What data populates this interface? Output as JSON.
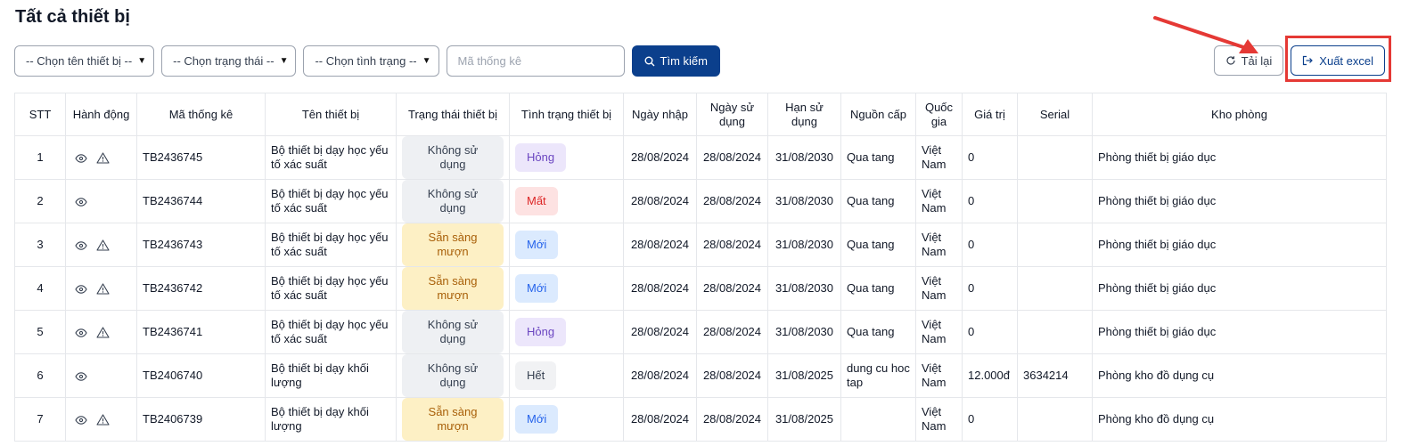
{
  "page_title": "Tất cả thiết bị",
  "filters": {
    "device_name": "-- Chọn tên thiết bị --",
    "status": "-- Chọn trạng thái --",
    "condition": "-- Chọn tình trạng --",
    "code_placeholder": "Mã thống kê",
    "search_label": "Tìm kiếm"
  },
  "actions": {
    "reload_label": "Tải lại",
    "export_label": "Xuất excel"
  },
  "table": {
    "headers": {
      "stt": "STT",
      "actions": "Hành động",
      "code": "Mã thống kê",
      "name": "Tên thiết bị",
      "status": "Trạng thái thiết bị",
      "condition": "Tình trạng thiết bị",
      "import_date": "Ngày nhập",
      "use_date": "Ngày sử dụng",
      "expiry": "Hạn sử dụng",
      "source": "Nguồn cấp",
      "country": "Quốc gia",
      "value": "Giá trị",
      "serial": "Serial",
      "room": "Kho phòng"
    },
    "rows": [
      {
        "stt": "1",
        "warn": true,
        "code": "TB2436745",
        "name": "Bộ thiết bị dạy học yếu tố xác suất",
        "status": "Không sử dụng",
        "status_tone": "gray",
        "condition": "Hỏng",
        "condition_tone": "purple",
        "import_date": "28/08/2024",
        "use_date": "28/08/2024",
        "expiry": "31/08/2030",
        "source": "Qua tang",
        "country": "Việt Nam",
        "value": "0",
        "serial": "",
        "room": "Phòng thiết bị giáo dục"
      },
      {
        "stt": "2",
        "warn": false,
        "code": "TB2436744",
        "name": "Bộ thiết bị dạy học yếu tố xác suất",
        "status": "Không sử dụng",
        "status_tone": "gray",
        "condition": "Mất",
        "condition_tone": "red",
        "import_date": "28/08/2024",
        "use_date": "28/08/2024",
        "expiry": "31/08/2030",
        "source": "Qua tang",
        "country": "Việt Nam",
        "value": "0",
        "serial": "",
        "room": "Phòng thiết bị giáo dục"
      },
      {
        "stt": "3",
        "warn": true,
        "code": "TB2436743",
        "name": "Bộ thiết bị dạy học yếu tố xác suất",
        "status": "Sẵn sàng mượn",
        "status_tone": "yellow",
        "condition": "Mới",
        "condition_tone": "blue",
        "import_date": "28/08/2024",
        "use_date": "28/08/2024",
        "expiry": "31/08/2030",
        "source": "Qua tang",
        "country": "Việt Nam",
        "value": "0",
        "serial": "",
        "room": "Phòng thiết bị giáo dục"
      },
      {
        "stt": "4",
        "warn": true,
        "code": "TB2436742",
        "name": "Bộ thiết bị dạy học yếu tố xác suất",
        "status": "Sẵn sàng mượn",
        "status_tone": "yellow",
        "condition": "Mới",
        "condition_tone": "blue",
        "import_date": "28/08/2024",
        "use_date": "28/08/2024",
        "expiry": "31/08/2030",
        "source": "Qua tang",
        "country": "Việt Nam",
        "value": "0",
        "serial": "",
        "room": "Phòng thiết bị giáo dục"
      },
      {
        "stt": "5",
        "warn": true,
        "code": "TB2436741",
        "name": "Bộ thiết bị dạy học yếu tố xác suất",
        "status": "Không sử dụng",
        "status_tone": "gray",
        "condition": "Hỏng",
        "condition_tone": "purple",
        "import_date": "28/08/2024",
        "use_date": "28/08/2024",
        "expiry": "31/08/2030",
        "source": "Qua tang",
        "country": "Việt Nam",
        "value": "0",
        "serial": "",
        "room": "Phòng thiết bị giáo dục"
      },
      {
        "stt": "6",
        "warn": false,
        "code": "TB2406740",
        "name": "Bộ thiết bị dạy khối lượng",
        "status": "Không sử dụng",
        "status_tone": "gray",
        "condition": "Hết",
        "condition_tone": "neutral",
        "import_date": "28/08/2024",
        "use_date": "28/08/2024",
        "expiry": "31/08/2025",
        "source": "dung cu hoc tap",
        "country": "Việt Nam",
        "value": "12.000đ",
        "serial": "3634214",
        "room": "Phòng kho đồ dụng cụ"
      },
      {
        "stt": "7",
        "warn": true,
        "code": "TB2406739",
        "name": "Bộ thiết bị dạy khối lượng",
        "status": "Sẵn sàng mượn",
        "status_tone": "yellow",
        "condition": "Mới",
        "condition_tone": "blue",
        "import_date": "28/08/2024",
        "use_date": "28/08/2024",
        "expiry": "31/08/2025",
        "source": "",
        "country": "Việt Nam",
        "value": "0",
        "serial": "",
        "room": "Phòng kho đồ dụng cụ"
      }
    ]
  },
  "icons": {
    "view": "eye-icon",
    "warning": "warning-icon",
    "search": "search-icon",
    "reload": "reload-icon",
    "export": "export-icon"
  },
  "colors": {
    "primary": "#0b3f8c",
    "annotation": "#e53935"
  }
}
